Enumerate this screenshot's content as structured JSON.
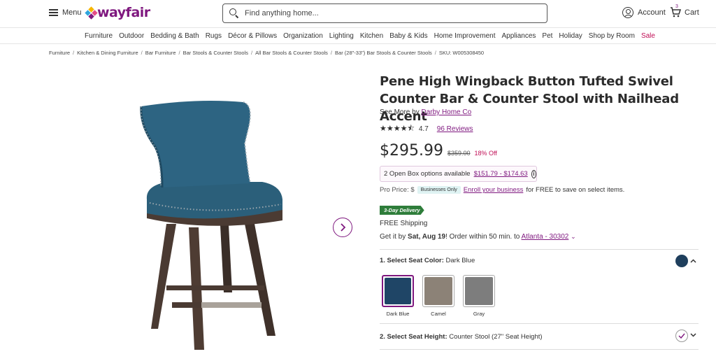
{
  "header": {
    "menu_label": "Menu",
    "logo_text": "wayfair",
    "search_placeholder": "Find anything home...",
    "account_label": "Account",
    "cart_label": "Cart",
    "cart_count": "3"
  },
  "nav": {
    "categories": [
      "Furniture",
      "Outdoor",
      "Bedding & Bath",
      "Rugs",
      "Décor & Pillows",
      "Organization",
      "Lighting",
      "Kitchen",
      "Baby & Kids",
      "Home Improvement",
      "Appliances",
      "Pet",
      "Holiday",
      "Shop by Room",
      "Sale"
    ]
  },
  "breadcrumb": [
    "Furniture",
    "Kitchen & Dining Furniture",
    "Bar Furniture",
    "Bar Stools & Counter Stools",
    "All Bar Stools & Counter Stools",
    "Bar (28\"-33\") Bar Stools & Counter Stools",
    "SKU: W005308450"
  ],
  "product": {
    "title": "Pene High Wingback Button Tufted Swivel Counter Bar & Counter Stool with Nailhead Accent",
    "see_more_prefix": "See More by",
    "brand": "Darby Home Co",
    "rating_value": "4.7",
    "rating_stars": 4.7,
    "reviews_label": "96 Reviews",
    "price": "$295.99",
    "was_price": "$359.00",
    "discount": "18% Off",
    "open_box_text": "2 Open Box options available",
    "open_box_range": "$151.79 - $174.63",
    "pro_price_label": "Pro Price: $",
    "businesses_only": "Businesses Only",
    "enroll_link": "Enroll your business",
    "enroll_rest": "for FREE to save on select items.",
    "delivery_badge": "3-Day Delivery",
    "free_shipping": "FREE Shipping",
    "get_it_prefix": "Get it by",
    "get_it_date": "Sat, Aug 19",
    "get_it_mid": "! Order within 50 min. to",
    "location": "Atlanta - 30302",
    "option1_label": "1. Select Seat Color:",
    "option1_value": "Dark Blue",
    "swatches": [
      {
        "label": "Dark Blue",
        "color": "#1f4566"
      },
      {
        "label": "Camel",
        "color": "#8c8277"
      },
      {
        "label": "Gray",
        "color": "#7d7d7d"
      }
    ],
    "option2_label": "2. Select Seat Height:",
    "option2_value": "Counter Stool (27\" Seat Height)"
  },
  "colors": {
    "brand": "#7f187f",
    "sale": "#c00f56",
    "delivery": "#2e7d3a",
    "selected_swatch": "#1f3f5d"
  }
}
